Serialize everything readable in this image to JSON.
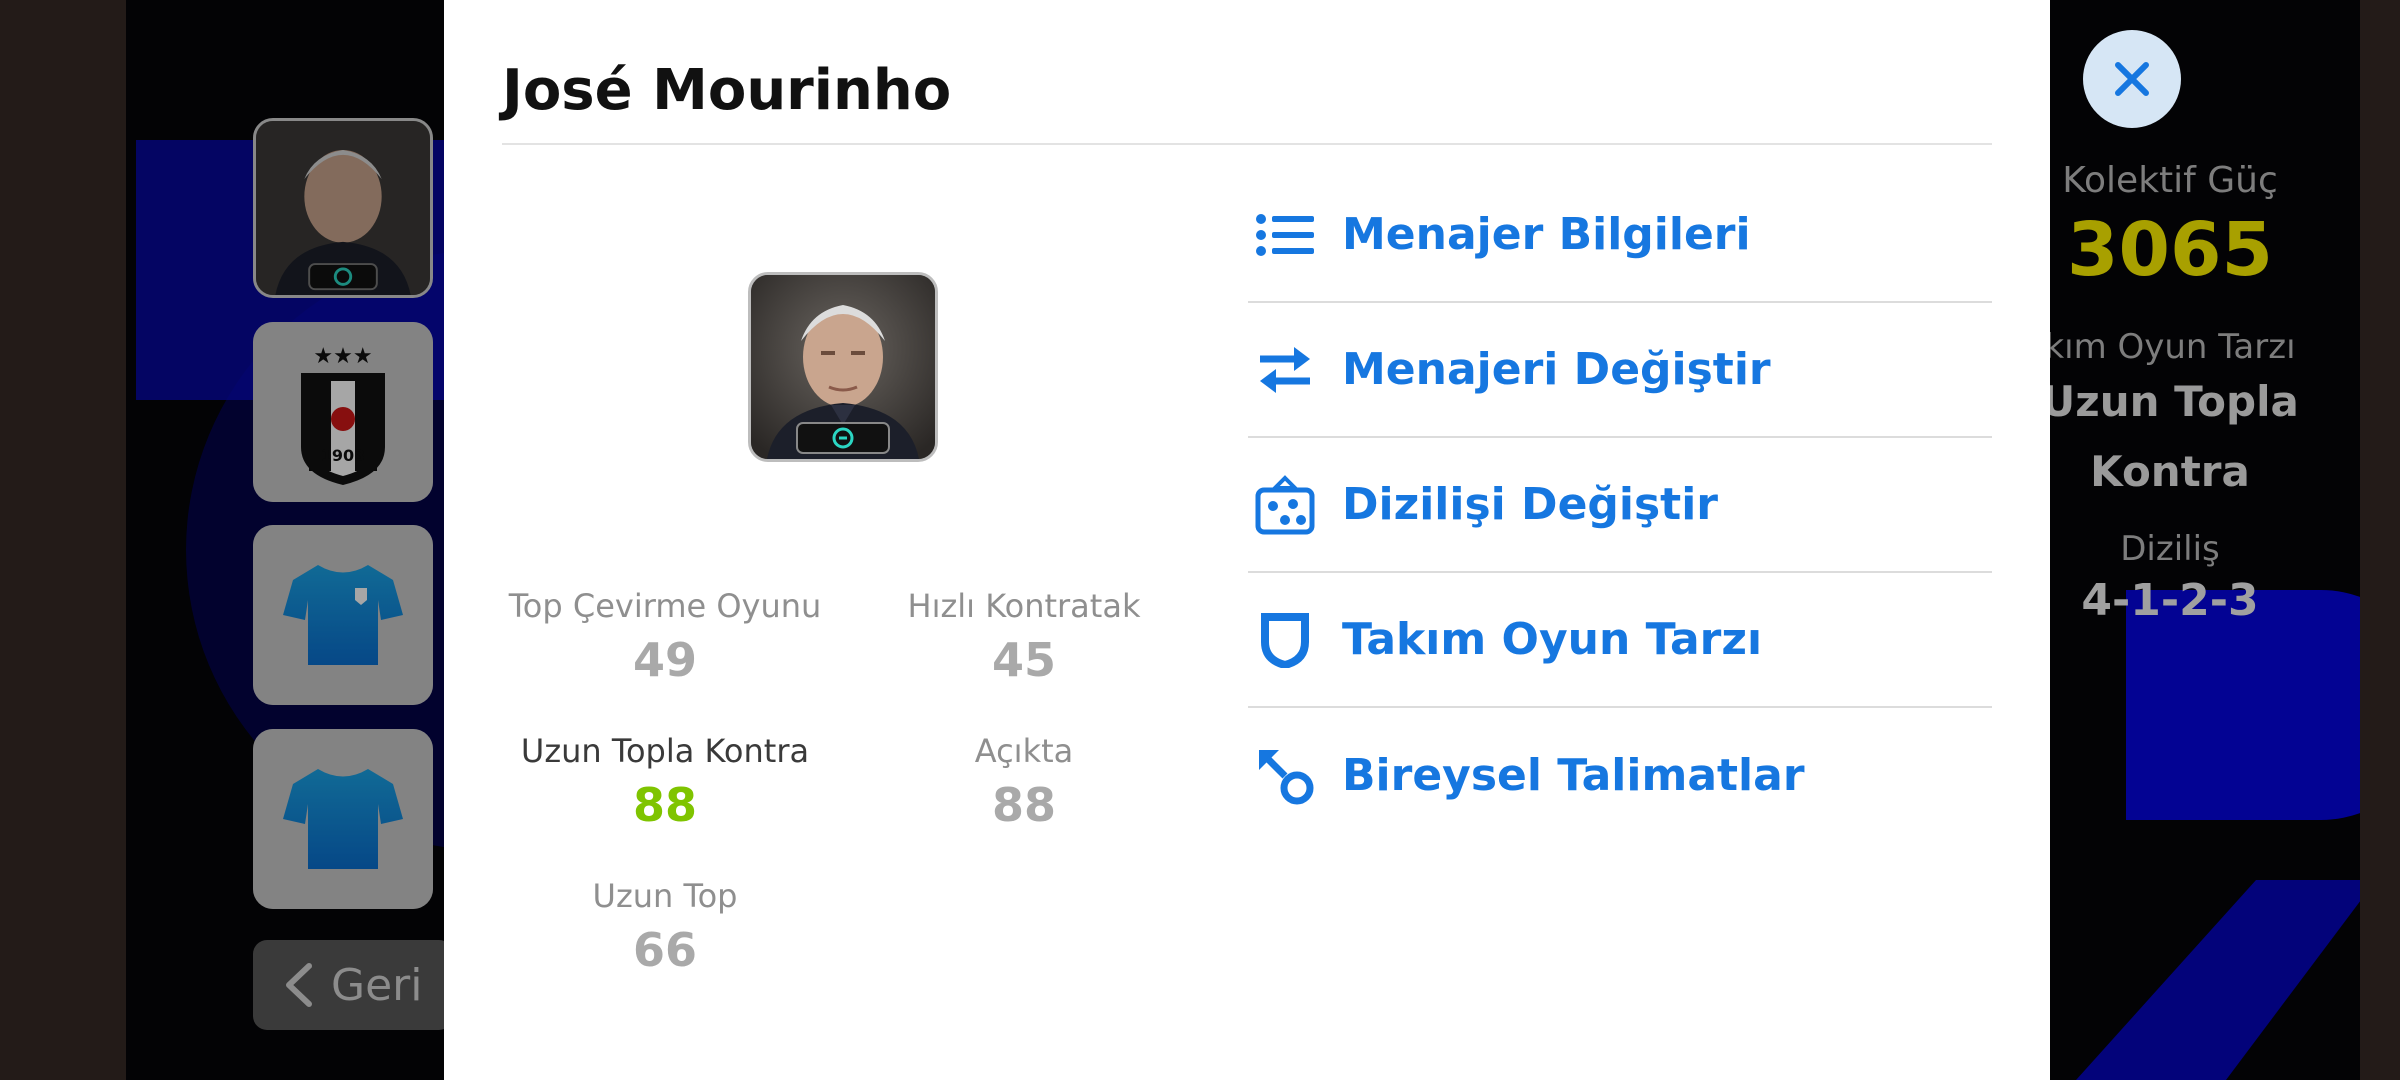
{
  "manager": {
    "name": "José Mourinho"
  },
  "stats": [
    {
      "label": "Top Çevirme Oyunu",
      "value": "49"
    },
    {
      "label": "Hızlı Kontratak",
      "value": "45"
    },
    {
      "label": "Uzun Topla Kontra",
      "value": "88"
    },
    {
      "label": "Açıkta",
      "value": "88"
    },
    {
      "label": "Uzun Top",
      "value": "66"
    }
  ],
  "menu": [
    {
      "label": "Menajer Bilgileri",
      "icon": "list-icon"
    },
    {
      "label": "Menajeri Değiştir",
      "icon": "swap-arrows-icon"
    },
    {
      "label": "Dizilişi Değiştir",
      "icon": "formation-board-icon"
    },
    {
      "label": "Takım Oyun Tarzı",
      "icon": "shield-icon"
    },
    {
      "label": "Bireysel Talimatlar",
      "icon": "arrow-target-icon"
    }
  ],
  "background": {
    "back_label": "Geri",
    "right_panel": {
      "power_label": "Kolektif Güç",
      "power_value": "3065",
      "style_label": "kım Oyun Tarzı",
      "style_line1": "Uzun Topla",
      "style_line2": "Kontra",
      "formation_label": "Diziliş",
      "formation_value": "4-1-2-3"
    }
  },
  "colors": {
    "accent": "#1677e0",
    "highlight_green": "#7fc400",
    "power_yellow": "#a8a000"
  }
}
